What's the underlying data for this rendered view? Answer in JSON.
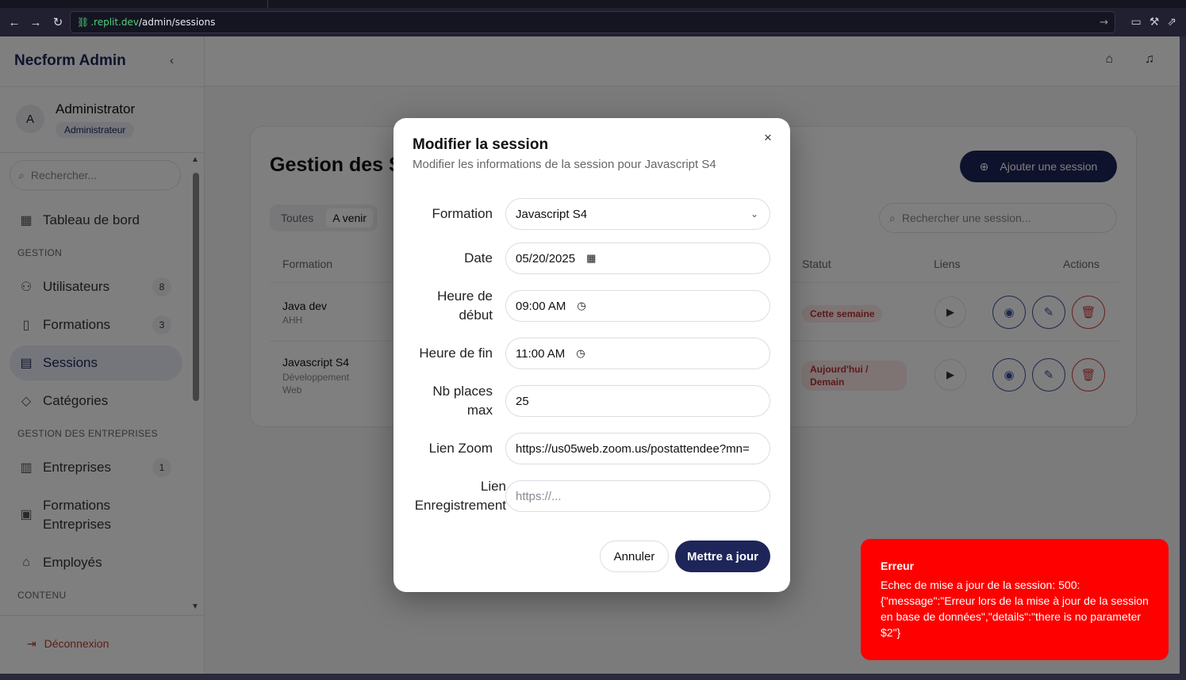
{
  "browser": {
    "url_host": ".replit.dev",
    "url_path": "/admin/sessions",
    "back_glyph": "←",
    "forward_glyph": "→",
    "reload_glyph": "↻",
    "go_glyph": "→"
  },
  "sidebar": {
    "brand": "Necform Admin",
    "collapse_glyph": "‹",
    "user": {
      "initial": "A",
      "name": "Administrator",
      "role": "Administrateur"
    },
    "search_placeholder": "Rechercher...",
    "items": [
      {
        "label": "Tableau de bord",
        "icon": "dashboard-icon"
      },
      {
        "label": "Utilisateurs",
        "icon": "users-icon",
        "count": "8"
      },
      {
        "label": "Formations",
        "icon": "book-icon",
        "count": "3"
      },
      {
        "label": "Sessions",
        "icon": "calendar-icon",
        "active": true
      },
      {
        "label": "Catégories",
        "icon": "tag-icon"
      },
      {
        "label": "Entreprises",
        "icon": "building-icon",
        "count": "1"
      },
      {
        "label": "Formations Entreprises",
        "icon": "briefcase-icon"
      },
      {
        "label": "Employés",
        "icon": "graduation-icon"
      }
    ],
    "sections": {
      "gestion": "GESTION",
      "entreprises": "GESTION DES ENTREPRISES",
      "contenu": "CONTENU"
    },
    "logout": "Déconnexion"
  },
  "page": {
    "heading": "Gestion des S",
    "add_button": "Ajouter une session",
    "filters": [
      "Toutes",
      "A venir"
    ],
    "search_placeholder": "Rechercher une session...",
    "columns": {
      "formation": "Formation",
      "statut": "Statut",
      "liens": "Liens",
      "actions": "Actions"
    },
    "rows": [
      {
        "name": "Java dev",
        "sub": "AHH",
        "status": "Cette semaine"
      },
      {
        "name": "Javascript S4",
        "sub": "Développement Web",
        "status": "Aujourd'hui / Demain"
      }
    ]
  },
  "modal": {
    "title": "Modifier la session",
    "description": "Modifier les informations de la session pour Javascript S4",
    "close_glyph": "×",
    "fields": {
      "formation": {
        "label": "Formation",
        "value": "Javascript S4"
      },
      "date": {
        "label": "Date",
        "value": "05/20/2025"
      },
      "start": {
        "label": "Heure de début",
        "value": "09:00 AM"
      },
      "end": {
        "label": "Heure de fin",
        "value": "11:00 AM"
      },
      "places": {
        "label": "Nb places max",
        "value": "25"
      },
      "zoom": {
        "label": "Lien Zoom",
        "value": "https://us05web.zoom.us/postattendee?mn="
      },
      "recording": {
        "label": "Lien Enregistrement",
        "placeholder": "https://..."
      }
    },
    "cancel": "Annuler",
    "submit": "Mettre a jour"
  },
  "toast": {
    "title": "Erreur",
    "message": "Echec de mise a jour de la session: 500: {\"message\":\"Erreur lors de la mise à jour de la session en base de données\",\"details\":\"there is no parameter $2\"}",
    "color": "#ff0000"
  },
  "colors": {
    "brand": "#1e2559",
    "danger": "#d03b3b"
  }
}
